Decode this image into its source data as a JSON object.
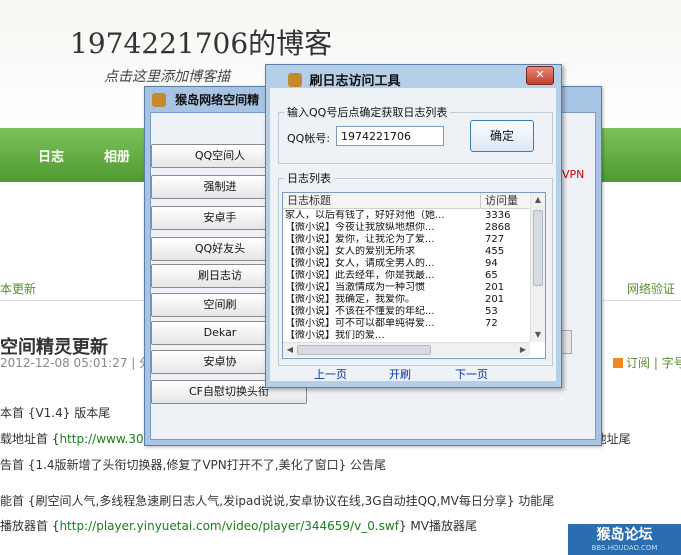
{
  "blog": {
    "title": "1974221706的博客",
    "subtitle": "点击这里添加博客描",
    "nav": [
      "日志",
      "相册"
    ],
    "crumb_left": "本更新",
    "crumb_right": "网络验证",
    "post_title": "空间精灵更新",
    "post_meta": "2012-12-08 05:01:27 | 分类",
    "rss": "订阅 | 字号",
    "lines": [
      {
        "pre": "本首 {V1.4} 版本尾",
        "link": "",
        "post": ""
      },
      {
        "pre": "载地址首 {",
        "link": "http://www.300.la/filestores/2012/12/12/9c59822be2ef60be81c2c1999a57ee4d.rar",
        "post": "} 下载地址尾"
      },
      {
        "pre": "告首 {1.4版新增了头衔切换器,修复了VPN打开不了,美化了窗口} 公告尾",
        "link": "",
        "post": ""
      },
      {
        "pre": "能首 {刷空间人气,多线程急速刷日志人气,发ipad说说,安卓协议在线,3G自动挂QQ,MV每日分享} 功能尾",
        "link": "",
        "post": ""
      },
      {
        "pre": "播放器首 {",
        "link": "http://player.yinyuetai.com/video/player/344659/v_0.swf",
        "post": "} MV播放器尾"
      }
    ],
    "watermark": "猴岛论坛",
    "watermark_url": "BBS.HOUDAO.COM"
  },
  "back_window": {
    "title": "猴岛网络空间精",
    "buttons": [
      "QQ空间人",
      "强制进",
      "安卓手",
      "QQ好友头",
      "刷日志访",
      "空间刷",
      "Dekar",
      "安卓协",
      "CF自慰切换头衔"
    ],
    "vpn_label": "VPN"
  },
  "front_window": {
    "title": "刷日志访问工具",
    "close": "✕",
    "group1_title": "输入QQ号后点确定获取日志列表",
    "qq_label": "QQ帐号:",
    "qq_value": "1974221706",
    "ok_button": "确定",
    "group2_title": "日志列表",
    "col_title": "日志标题",
    "col_count": "访问量",
    "rows": [
      {
        "title": "家人，以后有钱了，好好对他（她...",
        "count": "3336"
      },
      {
        "title": "【微小说】今夜让我放纵地想你...",
        "count": "2868"
      },
      {
        "title": "【微小说】爱你，让我沦为了爱...",
        "count": "727"
      },
      {
        "title": "【微小说】女人的爱别无所求",
        "count": "455"
      },
      {
        "title": "【微小说】女人，请成全男人的...",
        "count": "94"
      },
      {
        "title": "【微小说】此去经年，你是我最...",
        "count": "65"
      },
      {
        "title": "【微小说】当激情成为一种习惯",
        "count": "201"
      },
      {
        "title": "【微小说】我确定，我爱你。",
        "count": "201"
      },
      {
        "title": "【微小说】不该在不懂爱的年纪...",
        "count": "53"
      },
      {
        "title": "【微小说】可不可以都单纯得爱...",
        "count": "72"
      },
      {
        "title": "【微小说】我们的爱...",
        "count": ""
      }
    ],
    "pager": [
      "上一页",
      "开刷",
      "下一页"
    ]
  }
}
